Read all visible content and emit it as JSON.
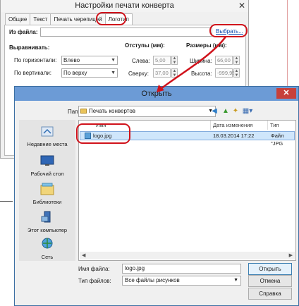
{
  "back_window": {
    "title": "Настройки печати конверта",
    "close_glyph": "✕",
    "tabs": [
      "Общие",
      "Текст",
      "Печать черепицей",
      "Логотип"
    ],
    "from_file_label": "Из файла:",
    "choose_link": "Выбрать...",
    "align_heading": "Выравнивать:",
    "horiz_label": "По горизонтали:",
    "horiz_value": "Влево",
    "vert_label": "По вертикали:",
    "vert_value": "По верху",
    "margins_heading": "Отступы (мм):",
    "left_label": "Слева:",
    "left_value": "5,00",
    "top_label": "Сверху:",
    "top_value": "37,00",
    "size_heading": "Размеры (мм):",
    "width_label": "Ширина:",
    "width_value": "66,00",
    "height_label": "Высота:",
    "height_value": "-999,95"
  },
  "open_dialog": {
    "title": "Открыть",
    "close_glyph": "✕",
    "folder_label": "Папка:",
    "folder_value": "Печать конвертов",
    "toolbar_icons": [
      "back-icon",
      "up-folder-icon",
      "new-folder-icon",
      "view-menu-icon"
    ],
    "places": [
      "Недавние места",
      "Рабочий стол",
      "Библиотеки",
      "Этот компьютер",
      "Сеть"
    ],
    "columns": [
      "Имя",
      "Дата изменения",
      "Тип"
    ],
    "files": [
      {
        "name": "logo.jpg",
        "modified": "18.03.2014 17:22",
        "type": "Файл \"JPG"
      }
    ],
    "filename_label": "Имя файла:",
    "filename_value": "logo.jpg",
    "filetype_label": "Тип файлов:",
    "filetype_value": "Все файлы рисунков",
    "buttons": {
      "open": "Открыть",
      "cancel": "Отмена",
      "help": "Справка"
    }
  },
  "colors": {
    "annotation": "#d0121b",
    "title_bar": "#6c9bd6",
    "link": "#0645ad"
  }
}
